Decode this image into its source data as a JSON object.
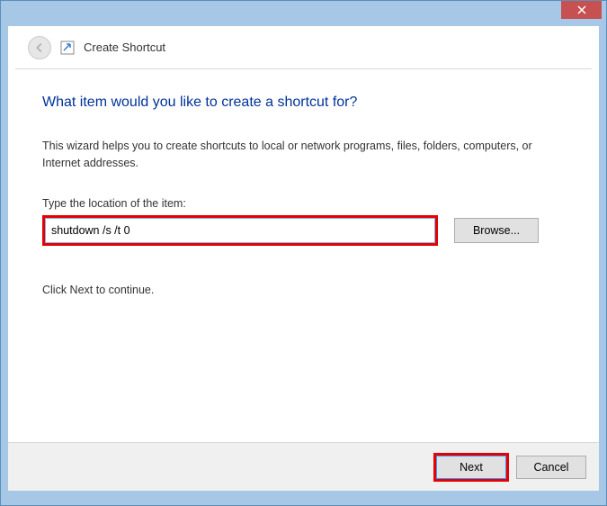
{
  "window": {
    "title": "Create Shortcut"
  },
  "content": {
    "heading": "What item would you like to create a shortcut for?",
    "description": "This wizard helps you to create shortcuts to local or network programs, files, folders, computers, or Internet addresses.",
    "field_label": "Type the location of the item:",
    "location_value": "shutdown /s /t 0",
    "browse_label": "Browse...",
    "continue_text": "Click Next to continue."
  },
  "footer": {
    "next_label": "Next",
    "cancel_label": "Cancel"
  },
  "icons": {
    "close": "close-icon",
    "back": "back-arrow-icon",
    "shortcut": "shortcut-icon"
  }
}
